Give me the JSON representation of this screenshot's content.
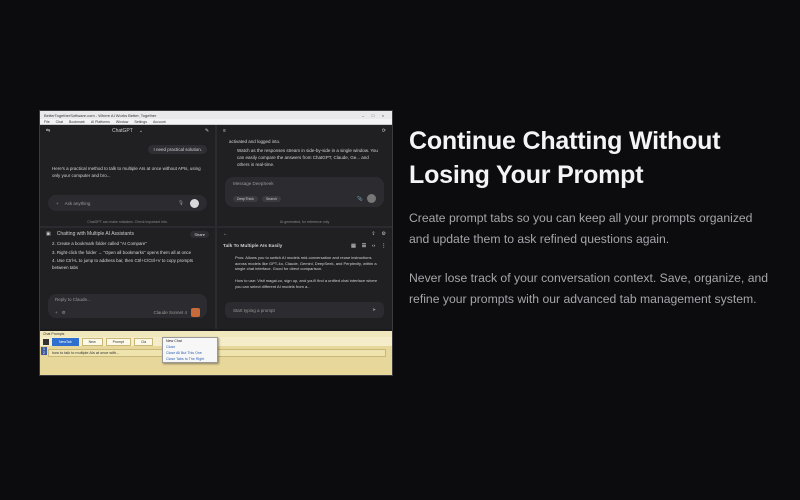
{
  "headline": "Continue Chatting Without Losing Your Prompt",
  "paragraphs": [
    "Create prompt tabs so you can keep all your prompts organized and update them to ask refined questions again.",
    "Never lose track of your conversation context. Save, organize, and refine your prompts with our advanced tab management system."
  ],
  "app": {
    "title": "BetterTogetherSoftware.com - Where AI Works Better, Together",
    "menu": [
      "File",
      "Chat",
      "Bookmark",
      "AI Platforms",
      "Window",
      "Settings",
      "Account"
    ],
    "panes": {
      "chatgpt": {
        "model": "ChatGPT",
        "user_msg": "I need practical solution.",
        "reply": "Here's a practical method to talk to multiple AIs at once without APIs, using only your computer and bro...",
        "placeholder": "Ask anything",
        "footer": "ChatGPT can make mistakes. Check important info."
      },
      "deepseek": {
        "line1": "activated and logged into.",
        "line2": "Watch as the responses stream in side-by-side in a single window. You can easily compare the answers from ChatGPT, Claude, Ge... and others in real-time.",
        "placeholder": "Message DeepSeek",
        "chip1": "DeepThink",
        "chip2": "Search",
        "footer": "AI-generated, for reference only"
      },
      "claude": {
        "title": "Chatting with Multiple AI Assistants",
        "share": "Share",
        "items": [
          "Create a bookmark folder called \"AI Compare\"",
          "Right-click the folder → \"Open all bookmarks\" opens them all at once",
          "Use Ctrl+L to jump to address bar, then Ctrl+C/Ctrl+V to copy prompts between tabs"
        ],
        "placeholder": "Reply to Claude...",
        "model": "Claude Sonnet 4"
      },
      "talk": {
        "title": "Talk To Multiple AIs Easily",
        "bullet1": "Pros: Allows you to switch AI models mid-conversation and reuse instructions across models like GPT-4o, Claude, Gemini, DeepSeek, and Perplexity, within a single chat interface. Good for direct comparison.",
        "bullet2": "How to use: Visit magai.co, sign up, and you'll find a unified chat interface where you can select different AI models from a...",
        "placeholder": "Start typing a prompt"
      }
    },
    "prompt_panel": {
      "title": "Chat Prompts",
      "tabs": [
        "NewTab",
        "New",
        "Prompt",
        "Cla"
      ],
      "text": "how to talk to multiple AIs at once with...",
      "context_menu": [
        "New Chat",
        "Close",
        "Close All But This One",
        "Close Tabs to The Right"
      ]
    }
  }
}
